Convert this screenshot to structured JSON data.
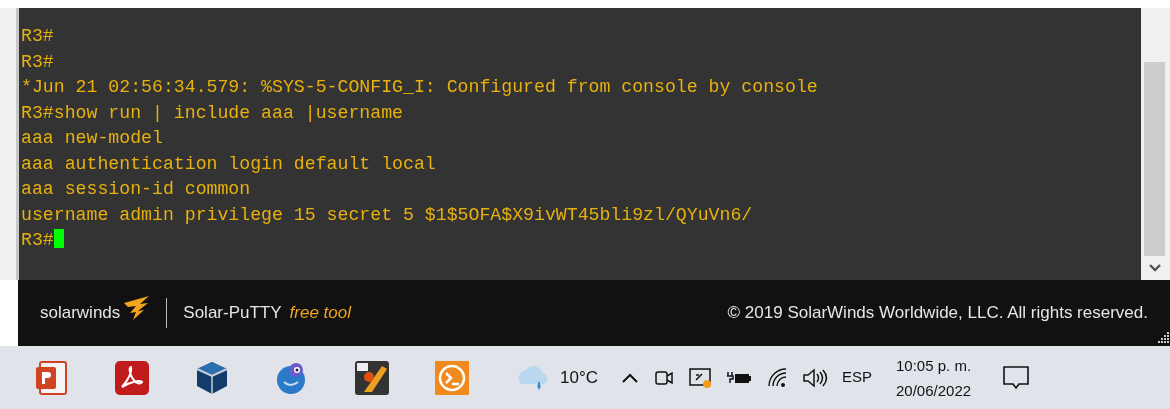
{
  "terminal": {
    "lines": [
      {
        "text": "R3#",
        "cursor": false
      },
      {
        "text": "R3#",
        "cursor": false
      },
      {
        "text": "*Jun 21 02:56:34.579: %SYS-5-CONFIG_I: Configured from console by console",
        "cursor": false
      },
      {
        "text": "R3#show run | include aaa |username",
        "cursor": false
      },
      {
        "text": "aaa new-model",
        "cursor": false
      },
      {
        "text": "aaa authentication login default local",
        "cursor": false
      },
      {
        "text": "aaa session-id common",
        "cursor": false
      },
      {
        "text": "username admin privilege 15 secret 5 $1$5OFA$X9ivWT45bli9zl/QYuVn6/",
        "cursor": false
      },
      {
        "text": "R3#",
        "cursor": true
      }
    ]
  },
  "footer": {
    "brand": "solarwinds",
    "product": "Solar-PuTTY",
    "tagline": "free tool",
    "copyright": "© 2019 SolarWinds Worldwide, LLC. All rights reserved."
  },
  "taskbar": {
    "temperature": "10°C",
    "language": "ESP",
    "time": "10:05 p. m.",
    "date": "20/06/2022"
  }
}
